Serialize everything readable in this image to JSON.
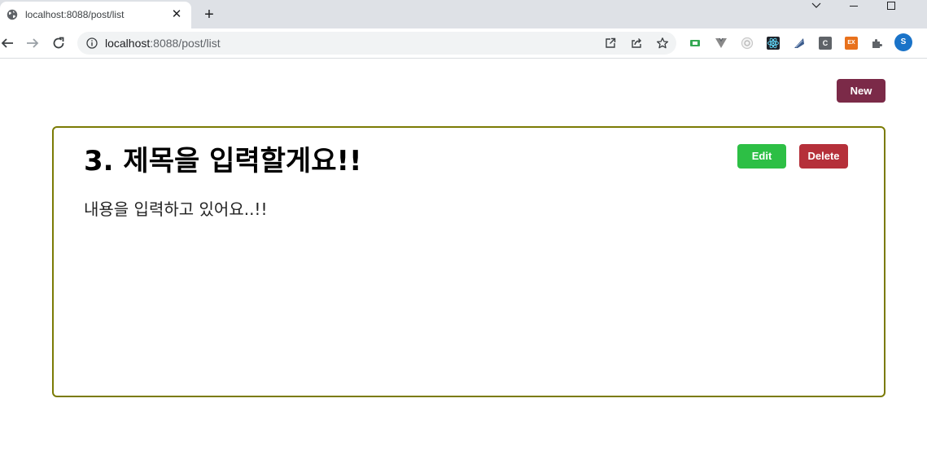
{
  "browser": {
    "tab": {
      "title": "localhost:8088/post/list",
      "close_glyph": "✕"
    },
    "new_tab_glyph": "+",
    "address": {
      "host": "localhost",
      "rest": ":8088/post/list"
    },
    "extensions": [
      {
        "name": "green-screen-extension-icon",
        "color": "#34a853",
        "label": ""
      },
      {
        "name": "vue-devtools-extension-icon",
        "color": "#8a8a8a",
        "label": ""
      },
      {
        "name": "circle-extension-icon",
        "color": "#c8c8c8",
        "label": ""
      },
      {
        "name": "react-devtools-extension-icon",
        "color": "#20232a",
        "label": ""
      },
      {
        "name": "wing-extension-icon",
        "color": "#3b5b8c",
        "label": ""
      },
      {
        "name": "c-extension-icon",
        "color": "#5f6368",
        "label": "C"
      },
      {
        "name": "ex-extension-icon",
        "color": "#e8711c",
        "label": "EX"
      }
    ],
    "profile_initial": "S"
  },
  "page": {
    "new_button": "New",
    "post": {
      "title": "3. 제목을 입력할게요!!",
      "content": "내용을 입력하고 있어요..!!",
      "edit_button": "Edit",
      "delete_button": "Delete"
    }
  },
  "colors": {
    "new_button": "#7b2a48",
    "edit_button": "#2dbf45",
    "delete_button": "#b5303a",
    "card_border": "#7b7b05"
  }
}
